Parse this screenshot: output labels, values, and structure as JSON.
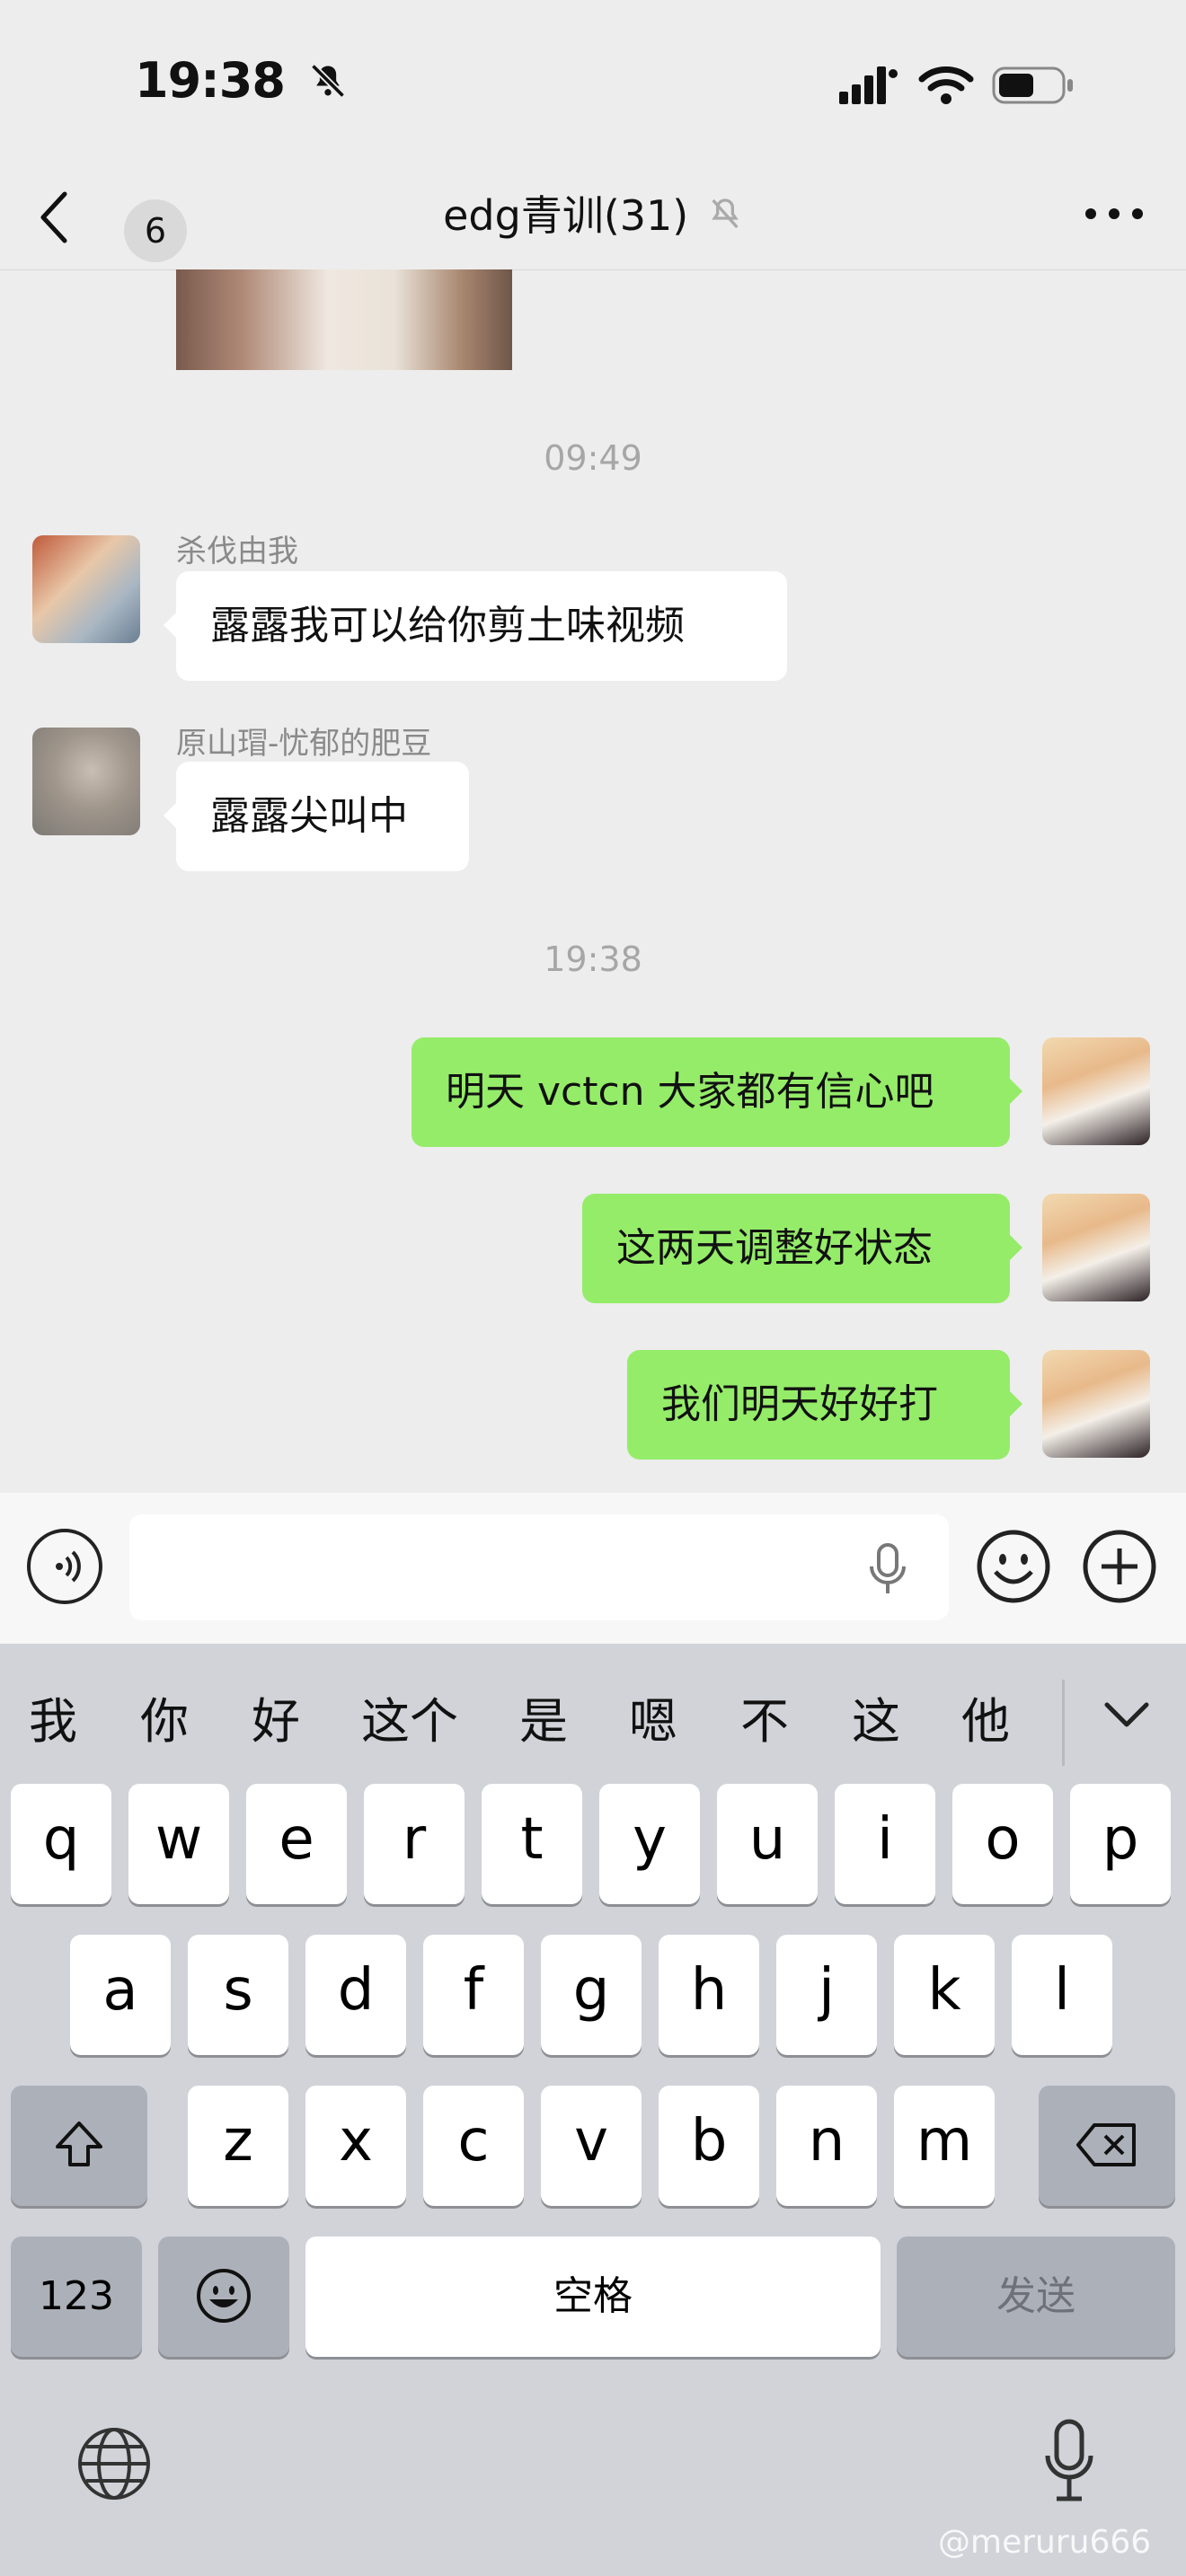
{
  "status": {
    "time": "19:38"
  },
  "nav": {
    "back_badge": "6",
    "title": "edg青训(31)"
  },
  "messages": [
    {
      "sender": "杀伐由我",
      "text": "露露我可以给你剪土味视频"
    },
    {
      "sender": "原山瑁-忧郁的肥豆",
      "text": "露露尖叫中"
    },
    {
      "text": "明天 vctcn 大家都有信心吧"
    },
    {
      "text": "这两天调整好状态"
    },
    {
      "text": "我们明天好好打"
    }
  ],
  "timestamps": [
    "09:49",
    "19:38"
  ],
  "input": {
    "value": "",
    "placeholder": ""
  },
  "keyboard": {
    "candidates": [
      "我",
      "你",
      "好",
      "这个",
      "是",
      "嗯",
      "不",
      "这",
      "他"
    ],
    "row1": [
      "q",
      "w",
      "e",
      "r",
      "t",
      "y",
      "u",
      "i",
      "o",
      "p"
    ],
    "row2": [
      "a",
      "s",
      "d",
      "f",
      "g",
      "h",
      "j",
      "k",
      "l"
    ],
    "row3": [
      "z",
      "x",
      "c",
      "v",
      "b",
      "n",
      "m"
    ],
    "numbers_label": "123",
    "space_label": "空格",
    "send_label": "发送"
  },
  "watermark": "@meruru666",
  "colors": {
    "background": "#ededed",
    "outgoing_bubble": "#95ec69",
    "incoming_bubble": "#ffffff",
    "keyboard": "#d1d3d9"
  },
  "icons": [
    "bell-off-icon",
    "signal-icon",
    "wifi-icon",
    "battery-icon",
    "back-icon",
    "mute-icon",
    "more-icon",
    "voice-icon",
    "microphone-icon",
    "emoji-icon",
    "plus-icon",
    "shift-icon",
    "backspace-icon",
    "globe-icon",
    "dictation-icon"
  ]
}
